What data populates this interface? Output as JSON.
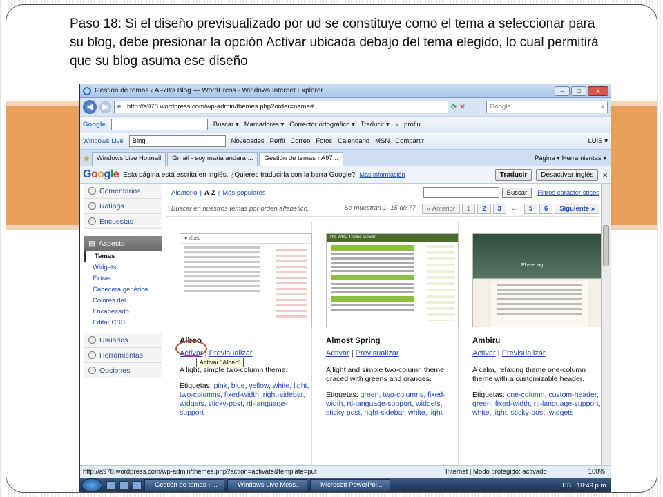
{
  "caption": "Paso 18: Si el diseño previsualizado por ud  se constituye como el tema a seleccionar para su blog, debe presionar la opción Activar ubicada debajo del tema elegido, lo cual permitirá que su blog asuma ese diseño",
  "browser": {
    "title": "Gestión de temas ‹ A978's Blog — WordPress - Windows Internet Explorer",
    "url": "http://a978.wordpress.com/wp-admin/themes.php?order=name#",
    "search_placeholder": "Google",
    "window_buttons": [
      "–",
      "□",
      "X"
    ]
  },
  "google_toolbar": {
    "logo": "Google",
    "items": [
      "Buscar ▾",
      "Marcadores ▾",
      "Corrector ortográfico ▾",
      "Traducir ▾",
      "»",
      "proflu..."
    ]
  },
  "wl_toolbar": {
    "label": "Windows Live",
    "search_value": "Bing",
    "items": [
      "Novedades",
      "Perfil",
      "Correo",
      "Fotos",
      "Calendario",
      "MSN",
      "Compartir"
    ],
    "user": "LUIS ▾"
  },
  "tabs": [
    {
      "label": "Windows Live Hotmail"
    },
    {
      "label": "Gmail - soy maria andara ..."
    },
    {
      "label": "Gestión de temas ‹ A97..."
    }
  ],
  "tab_tools": "Página ▾  Herramientas ▾",
  "translate_bar": {
    "logo": "Google",
    "message": "Esta página está escrita en inglés. ¿Quieres traducirla con la barra Google?",
    "more_info": "Más información",
    "translate_btn": "Traducir",
    "disable_btn": "Desactivar inglés",
    "close": "×"
  },
  "sidebar": {
    "top_items": [
      "Comentarios",
      "Ratings",
      "Encuestas"
    ],
    "section": "Aspecto",
    "sub_items": [
      "Temas",
      "Widgets",
      "Extras",
      "Cabecera genérica.",
      "Colores del Encabezado",
      "Editar CSS"
    ],
    "bottom_items": [
      "Usuarios",
      "Herramientas",
      "Opciones"
    ]
  },
  "filter": {
    "links": [
      "Aleatorio",
      "A-Z",
      "Más populares"
    ],
    "search_btn": "Buscar",
    "features_link": "Filtros característicos"
  },
  "paging": {
    "hint": "Buscar en nuestros temas por orden alfabético.",
    "count": "Se muestran 1–15 de 77",
    "prev": "« Anterior",
    "pages": [
      "1",
      "2",
      "3",
      "...",
      "5",
      "6"
    ],
    "next": "Siguiente »"
  },
  "themes": [
    {
      "name": "Albeo",
      "activate": "Activar",
      "preview": "Previsualizar",
      "desc": "A light, simple two-column theme.",
      "tags_label": "Etiquetas:",
      "tags": "pink, blue, yellow, white, light, two-columns, fixed-width, right-sidebar, widgets, sticky-post, rtl-language-support",
      "tooltip": "Activar \"Albeo\""
    },
    {
      "name": "Almost Spring",
      "activate": "Activar",
      "preview": "Previsualizar",
      "desc": "A light and simple two-column theme graced with greens and oranges.",
      "tags_label": "Etiquetas:",
      "tags": "green, two-columns, fixed-width, rtl-language-support, widgets, sticky-post, right-sidebar, white, light"
    },
    {
      "name": "Ambiru",
      "activate": "Activar",
      "preview": "Previsualizar",
      "desc": "A calm, relaxing theme one-column theme with a customizable header.",
      "tags_label": "Etiquetas:",
      "tags": "one-column, custom-header, green, fixed-width, rtl-language-support, white, light, sticky-post, widgets"
    }
  ],
  "status_bar": {
    "url": "http://a978.wordpress.com/wp-admin/themes.php?action=activate&template=put",
    "zone": "Internet | Modo protegido: activado",
    "zoom": "100%"
  },
  "taskbar": {
    "buttons": [
      "Gestión de temas ‹ ...",
      "Windows Live Mess...",
      "Microsoft PowerPoi..."
    ],
    "lang": "ES",
    "time": "10:49 p.m."
  }
}
